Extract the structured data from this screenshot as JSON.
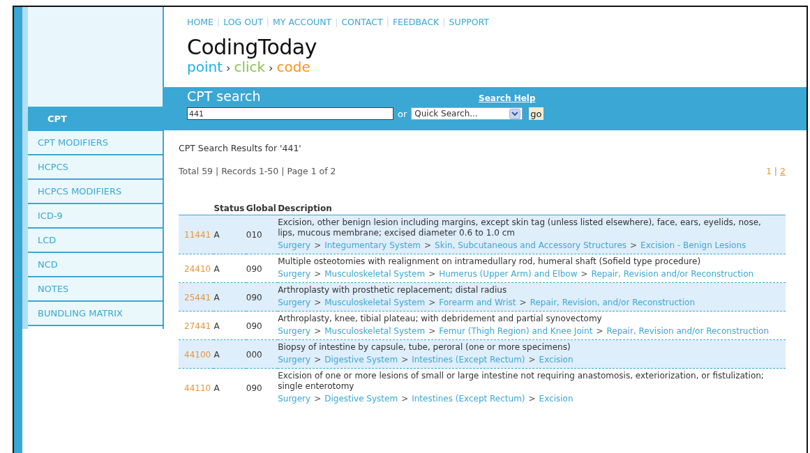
{
  "top_nav": {
    "separator": "|",
    "items": [
      "HOME",
      "LOG OUT",
      "MY ACCOUNT",
      "CONTACT",
      "FEEDBACK",
      "SUPPORT"
    ]
  },
  "logo": {
    "name": "CodingToday",
    "separator": "›",
    "tagline": [
      {
        "text": "point",
        "color": "#1fb0e3"
      },
      {
        "text": "click",
        "color": "#8cc152"
      },
      {
        "text": "code",
        "color": "#f7941d"
      }
    ]
  },
  "sidebar": {
    "items": [
      {
        "label": "CPT",
        "selected": true
      },
      {
        "label": "CPT MODIFIERS",
        "selected": false
      },
      {
        "label": "HCPCS",
        "selected": false
      },
      {
        "label": "HCPCS MODIFIERS",
        "selected": false
      },
      {
        "label": "ICD-9",
        "selected": false
      },
      {
        "label": "LCD",
        "selected": false
      },
      {
        "label": "NCD",
        "selected": false
      },
      {
        "label": "NOTES",
        "selected": false
      },
      {
        "label": "BUNDLING MATRIX",
        "selected": false
      }
    ]
  },
  "search": {
    "title": "CPT search",
    "help_link": "Search Help",
    "value": "441",
    "or_label": "or",
    "quick_search": "Quick Search...",
    "go_button": "go"
  },
  "results": {
    "heading": "CPT Search Results for '441'",
    "summary": "Total 59 | Records 1-50 | Page 1 of 2",
    "pages_separator": "|",
    "pages": [
      {
        "label": "1",
        "selected": true
      },
      {
        "label": "2",
        "selected": false
      }
    ],
    "columns": [
      "",
      "Status",
      "Global",
      "Description"
    ],
    "path_separator": ">",
    "rows": [
      {
        "code": "11441",
        "status": "A",
        "global": "010",
        "description": "Excision, other benign lesion including margins, except skin tag (unless listed elsewhere), face, ears, eyelids, nose, lips, mucous membrane; excised diameter 0.6 to 1.0 cm",
        "path": [
          "Surgery",
          "Integumentary System",
          "Skin, Subcutaneous and Accessory Structures",
          "Excision - Benign Lesions"
        ]
      },
      {
        "code": "24410",
        "status": "A",
        "global": "090",
        "description": "Multiple osteotomies with realignment on intramedullary rod, humeral shaft (Sofield type procedure)",
        "path": [
          "Surgery",
          "Musculoskeletal System",
          "Humerus (Upper Arm) and Elbow",
          "Repair, Revision and/or Reconstruction"
        ]
      },
      {
        "code": "25441",
        "status": "A",
        "global": "090",
        "description": "Arthroplasty with prosthetic replacement; distal radius",
        "path": [
          "Surgery",
          "Musculoskeletal System",
          "Forearm and Wrist",
          "Repair, Revision, and/or Reconstruction"
        ]
      },
      {
        "code": "27441",
        "status": "A",
        "global": "090",
        "description": "Arthroplasty, knee, tibial plateau; with debridement and partial synovectomy",
        "path": [
          "Surgery",
          "Musculoskeletal System",
          "Femur (Thigh Region) and Knee Joint",
          "Repair, Revision and/or Reconstruction"
        ]
      },
      {
        "code": "44100",
        "status": "A",
        "global": "000",
        "description": "Biopsy of intestine by capsule, tube, peroral (one or more specimens)",
        "path": [
          "Surgery",
          "Digestive System",
          "Intestines (Except Rectum)",
          "Excision"
        ]
      },
      {
        "code": "44110",
        "status": "A",
        "global": "090",
        "description": "Excision of one or more lesions of small or large intestine not requiring anastomosis, exteriorization, or fistulization; single enterotomy",
        "path": [
          "Surgery",
          "Digestive System",
          "Intestines (Except Rectum)",
          "Excision"
        ]
      }
    ]
  }
}
